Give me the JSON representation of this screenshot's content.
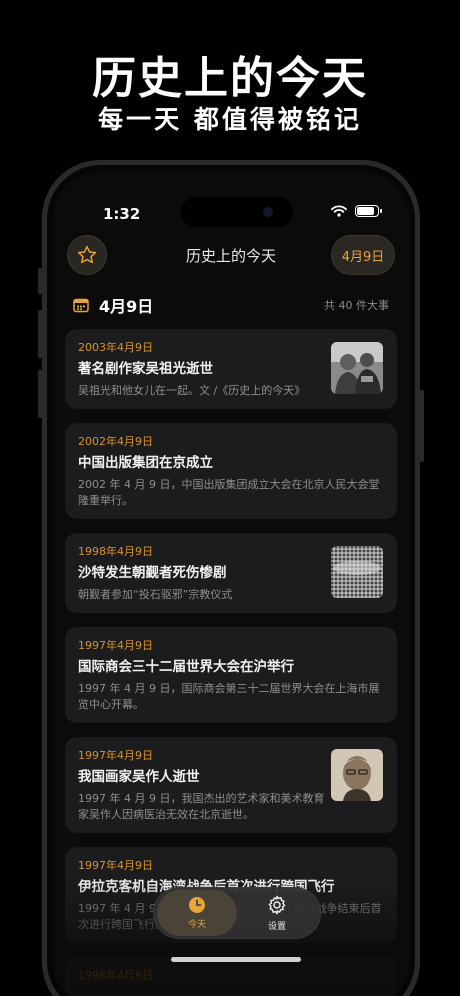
{
  "promo": {
    "title": "历史上的今天",
    "subtitle": "每一天 都值得被铭记"
  },
  "status_bar": {
    "time": "1:32"
  },
  "nav": {
    "title": "历史上的今天",
    "date_button": "4月9日",
    "favorite_icon": "star-icon"
  },
  "section": {
    "date": "4月9日",
    "count": "共 40 件大事",
    "icon": "calendar-icon"
  },
  "events": [
    {
      "date": "2003年4月9日",
      "title": "著名剧作家吴祖光逝世",
      "desc": "吴祖光和他女儿在一起。文 /《历史上的今天》"
    },
    {
      "date": "2002年4月9日",
      "title": "中国出版集团在京成立",
      "desc": "2002 年 4 月 9 日，中国出版集团成立大会在北京人民大会堂隆重举行。"
    },
    {
      "date": "1998年4月9日",
      "title": "沙特发生朝觐者死伤惨剧",
      "desc": "朝觐者参加“投石驱邪”宗教仪式"
    },
    {
      "date": "1997年4月9日",
      "title": "国际商会三十二届世界大会在沪举行",
      "desc": "1997 年 4 月 9 日，国际商会第三十二届世界大会在上海市展览中心开幕。"
    },
    {
      "date": "1997年4月9日",
      "title": "我国画家吴作人逝世",
      "desc": "1997 年 4 月 9 日，我国杰出的艺术家和美术教育家吴作人因病医治无效在北京逝世。"
    },
    {
      "date": "1997年4月9日",
      "title": "伊拉克客机自海湾战争后首次进行跨国飞行",
      "desc": "1997 年 4 月 9 日，伊拉克客机自 1990 年海湾战争结束后首次进行跨国飞行。"
    },
    {
      "date": "1998年4月9日",
      "title": "",
      "desc": ""
    }
  ],
  "tabs": [
    {
      "label": "今天",
      "icon": "clock-icon",
      "active": true
    },
    {
      "label": "设置",
      "icon": "gear-icon",
      "active": false
    }
  ],
  "colors": {
    "accent": "#e6a53a",
    "background": "#0b0b0b",
    "card": "#1c1c1e",
    "secondary_text": "#8e8e93"
  }
}
